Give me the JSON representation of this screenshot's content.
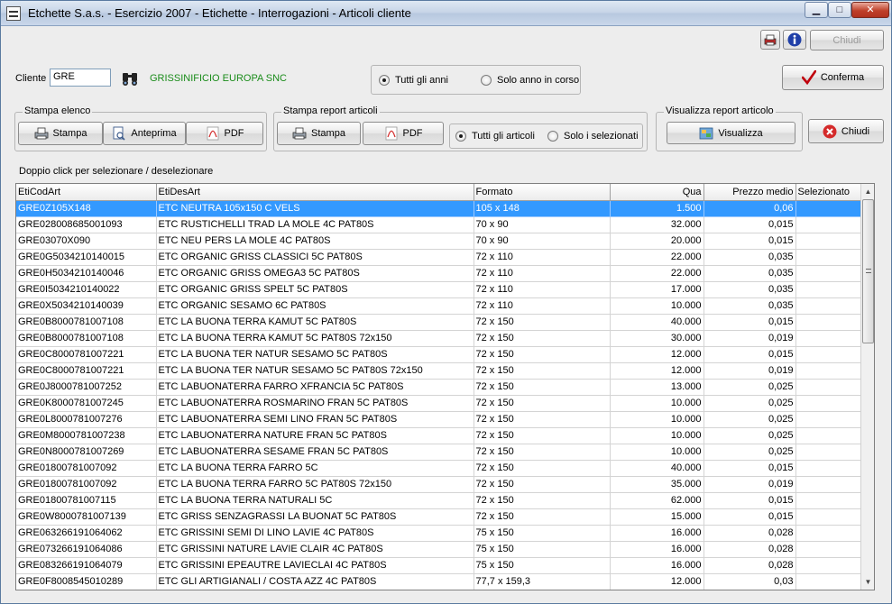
{
  "window": {
    "title": "Etchette S.a.s. - Esercizio 2007 - Etichette - Interrogazioni - Articoli cliente",
    "min_glyph": "▁",
    "max_glyph": "□",
    "close_glyph": "✕"
  },
  "toolbar": {
    "chiudi_top_label": "Chiudi"
  },
  "cliente": {
    "label": "Cliente",
    "value": "GRE",
    "name": "GRISSINIFICIO EUROPA SNC"
  },
  "years": {
    "all_label": "Tutti gli anni",
    "current_label": "Solo anno in corso"
  },
  "conferma_label": "Conferma",
  "stampa_elenco": {
    "title": "Stampa elenco",
    "stampa_label": "Stampa",
    "anteprima_label": "Anteprima",
    "pdf_label": "PDF"
  },
  "stampa_report": {
    "title": "Stampa report articoli",
    "stampa_label": "Stampa",
    "pdf_label": "PDF",
    "all_label": "Tutti gli articoli",
    "selected_label": "Solo i selezionati"
  },
  "visualizza": {
    "title": "Visualizza report articolo",
    "button_label": "Visualizza"
  },
  "chiudi_label": "Chiudi",
  "hint": "Doppio click per selezionare / deselezionare",
  "colors": {
    "selected_row": "#3399ff",
    "customer_name": "#1a8c1a",
    "confirm_check": "#c0000c",
    "close_icon": "#d42a2a"
  },
  "grid": {
    "columns": [
      "EtiCodArt",
      "EtiDesArt",
      "Formato",
      "Qua",
      "Prezzo medio",
      "Selezionato"
    ],
    "rows": [
      [
        "GRE0Z105X148",
        "ETC NEUTRA 105x150  C VELS",
        "105 x 148",
        "1.500",
        "0,06",
        ""
      ],
      [
        "GRE028008685001093",
        "ETC RUSTICHELLI TRAD LA MOLE  4C PAT80S",
        "70 x 90",
        "32.000",
        "0,015",
        ""
      ],
      [
        "GRE03070X090",
        "ETC NEU PERS LA MOLE  4C PAT80S",
        "70 x 90",
        "20.000",
        "0,015",
        ""
      ],
      [
        "GRE0G5034210140015",
        "ETC ORGANIC GRISS CLASSICI  5C PAT80S",
        "72 x 110",
        "22.000",
        "0,035",
        ""
      ],
      [
        "GRE0H5034210140046",
        "ETC ORGANIC GRISS OMEGA3  5C PAT80S",
        "72 x 110",
        "22.000",
        "0,035",
        ""
      ],
      [
        "GRE0I5034210140022",
        "ETC ORGANIC GRISS SPELT  5C PAT80S",
        "72 x 110",
        "17.000",
        "0,035",
        ""
      ],
      [
        "GRE0X5034210140039",
        "ETC ORGANIC SESAMO  6C PAT80S",
        "72 x 110",
        "10.000",
        "0,035",
        ""
      ],
      [
        "GRE0B8000781007108",
        "ETC LA BUONA TERRA KAMUT  5C PAT80S",
        "72 x 150",
        "40.000",
        "0,015",
        ""
      ],
      [
        "GRE0B8000781007108",
        "ETC LA BUONA TERRA KAMUT  5C PAT80S 72x150",
        "72 x 150",
        "30.000",
        "0,019",
        ""
      ],
      [
        "GRE0C8000781007221",
        "ETC LA BUONA TER  NATUR SESAMO  5C PAT80S",
        "72 x 150",
        "12.000",
        "0,015",
        ""
      ],
      [
        "GRE0C8000781007221",
        "ETC LA BUONA TER  NATUR SESAMO  5C PAT80S 72x150",
        "72 x 150",
        "12.000",
        "0,019",
        ""
      ],
      [
        "GRE0J8000781007252",
        "ETC LABUONATERRA FARRO XFRANCIA  5C PAT80S",
        "72 x 150",
        "13.000",
        "0,025",
        ""
      ],
      [
        "GRE0K8000781007245",
        "ETC LABUONATERRA ROSMARINO FRAN  5C PAT80S",
        "72 x 150",
        "10.000",
        "0,025",
        ""
      ],
      [
        "GRE0L8000781007276",
        "ETC LABUONATERRA SEMI LINO FRAN  5C PAT80S",
        "72 x 150",
        "10.000",
        "0,025",
        ""
      ],
      [
        "GRE0M8000781007238",
        "ETC LABUONATERRA NATURE FRAN  5C PAT80S",
        "72 x 150",
        "10.000",
        "0,025",
        ""
      ],
      [
        "GRE0N8000781007269",
        "ETC LABUONATERRA SESAME FRAN  5C PAT80S",
        "72 x 150",
        "10.000",
        "0,025",
        ""
      ],
      [
        "GRE01800781007092",
        "ETC LA BUONA TERRA FARRO  5C",
        "72 x 150",
        "40.000",
        "0,015",
        ""
      ],
      [
        "GRE01800781007092",
        "ETC LA BUONA TERRA FARRO  5C PAT80S 72x150",
        "72 x 150",
        "35.000",
        "0,019",
        ""
      ],
      [
        "GRE01800781007115",
        "ETC LA BUONA TERRA NATURALI  5C",
        "72 x 150",
        "62.000",
        "0,015",
        ""
      ],
      [
        "GRE0W8000781007139",
        "ETC GRISS SENZAGRASSI LA BUONAT  5C PAT80S",
        "72 x 150",
        "15.000",
        "0,015",
        ""
      ],
      [
        "GRE063266191064062",
        "ETC GRISSINI SEMI DI LINO LAVIE  4C PAT80S",
        "75 x 150",
        "16.000",
        "0,028",
        ""
      ],
      [
        "GRE073266191064086",
        "ETC GRISSINI NATURE LAVIE CLAIR  4C PAT80S",
        "75 x 150",
        "16.000",
        "0,028",
        ""
      ],
      [
        "GRE083266191064079",
        "ETC GRISSINI EPEAUTRE LAVIECLAI  4C PAT80S",
        "75 x 150",
        "16.000",
        "0,028",
        ""
      ],
      [
        "GRE0F8008545010289",
        "ETC GLI ARTIGIANALI / COSTA AZZ  4C PAT80S",
        "77,7 x 159,3",
        "12.000",
        "0,03",
        ""
      ]
    ]
  }
}
